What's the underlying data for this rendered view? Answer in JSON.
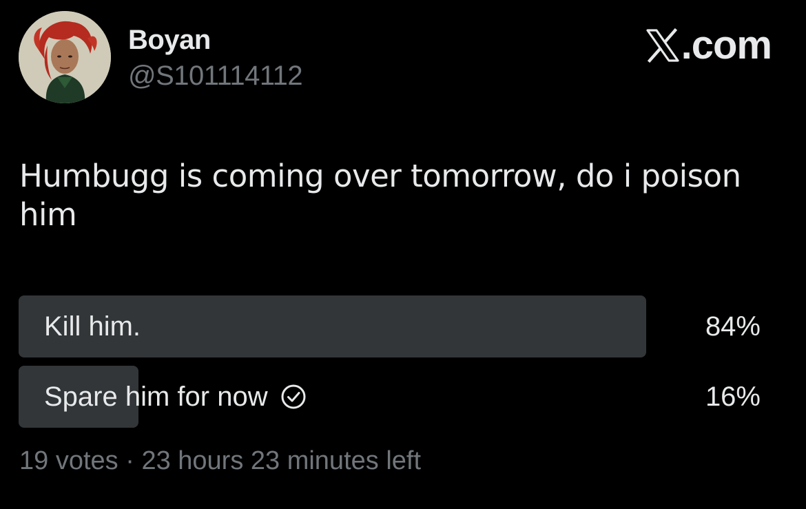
{
  "user": {
    "display_name": "Boyan",
    "handle": "@S101114112"
  },
  "brand": {
    "icon": "x-logo-icon",
    "text": ".com"
  },
  "tweet": {
    "text": "Humbugg is coming over tomorrow, do i poison him"
  },
  "poll": {
    "options": [
      {
        "label": "Kill him.",
        "percent_text": "84%",
        "fraction": 0.84,
        "selected": false
      },
      {
        "label": "Spare him for now",
        "percent_text": "16%",
        "fraction": 0.16,
        "selected": true
      }
    ],
    "votes": "19 votes",
    "separator": "·",
    "time_left": "23 hours 23 minutes left"
  },
  "colors": {
    "background": "#000000",
    "text_primary": "#e7e9ea",
    "text_secondary": "#71767b",
    "poll_bar": "#333639"
  }
}
